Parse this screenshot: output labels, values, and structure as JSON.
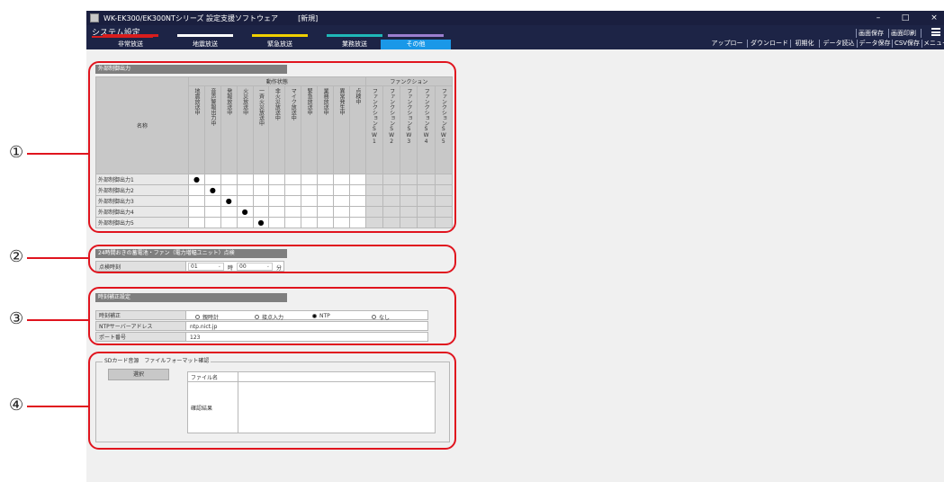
{
  "window": {
    "title": "WK-EK300/EK300NTシリーズ 設定支援ソフトウェア",
    "doc_state": "[新規]",
    "controls": [
      "–",
      "□",
      "×"
    ]
  },
  "header": {
    "section_title": "システム設定",
    "tabs": [
      {
        "label": "非常放送",
        "bar_color": "#d81d1d"
      },
      {
        "label": "地震放送",
        "bar_color": "#ffffff"
      },
      {
        "label": "緊急放送",
        "bar_color": "#f0d000"
      },
      {
        "label": "業務放送",
        "bar_color": "#1fb8b8"
      },
      {
        "label": "その他",
        "bar_color": "#9b7fd0"
      }
    ],
    "screen_save": "画面保存",
    "screen_print": "画面印刷",
    "toolbar": [
      "アップロード",
      "ダウンロード",
      "初期化",
      "データ読込",
      "データ保存",
      "CSV保存",
      "メニュー"
    ]
  },
  "section1": {
    "title": "外部制御出力",
    "name_header": "名称",
    "group_status": "動作状態",
    "group_function": "ファンクション",
    "status_columns": [
      "地震放送中",
      "音声警報出力中",
      "発報放送中",
      "火災放送中",
      "一斉火災放送中",
      "非火災放送中",
      "マイク放送中",
      "緊急放送中",
      "業務放送中",
      "異常発生中",
      "点検中"
    ],
    "function_columns": [
      "ファンクションSW1",
      "ファンクションSW2",
      "ファンクションSW3",
      "ファンクションSW4",
      "ファンクションSW5"
    ],
    "rows": [
      {
        "label": "外部制御出力1",
        "dot_col": 0
      },
      {
        "label": "外部制御出力2",
        "dot_col": 1
      },
      {
        "label": "外部制御出力3",
        "dot_col": 2
      },
      {
        "label": "外部制御出力4",
        "dot_col": 3
      },
      {
        "label": "外部制御出力5",
        "dot_col": 4
      }
    ],
    "dot_glyph": "●"
  },
  "section2": {
    "title": "24時間おきの蓄電池・ファン（電力増幅ユニット）点検",
    "label": "点検時刻",
    "hour_value": "01",
    "hour_unit": "時",
    "minute_value": "00",
    "minute_unit": "分",
    "caret": "⌄"
  },
  "section3": {
    "title": "時刻補正設定",
    "correction_label": "時刻補正",
    "options": [
      {
        "label": "親時計",
        "selected": false
      },
      {
        "label": "接点入力",
        "selected": false
      },
      {
        "label": "NTP",
        "selected": true
      },
      {
        "label": "なし",
        "selected": false
      }
    ],
    "ntp_label": "NTPサーバーアドレス",
    "ntp_value": "ntp.nict.jp",
    "port_label": "ポート番号",
    "port_value": "123"
  },
  "section4": {
    "title": "SDカード音源　ファイルフォーマット確認",
    "select_button": "選択",
    "filename_label": "ファイル名",
    "result_label": "確認結果"
  },
  "callouts": [
    "①",
    "②",
    "③",
    "④"
  ],
  "colors": {
    "titlebar": "#1a1f3f",
    "header": "#1d2446",
    "active_tab": "#1a98e8",
    "callout": "#e0141e"
  }
}
